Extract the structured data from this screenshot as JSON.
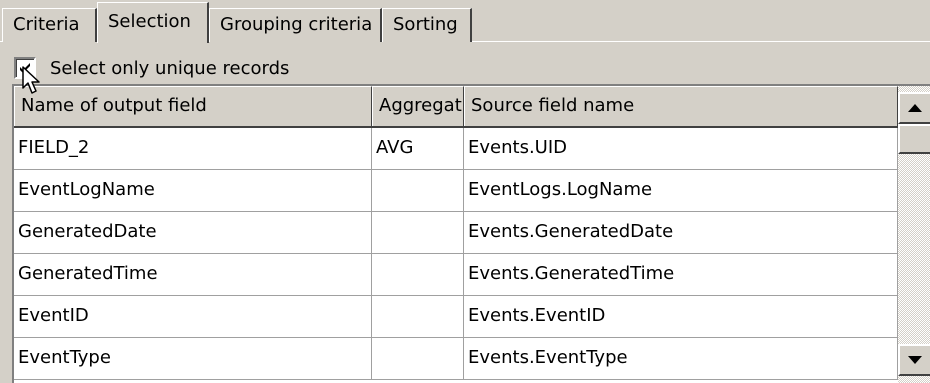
{
  "tabs": [
    {
      "label": "Criteria",
      "active": false
    },
    {
      "label": "Selection",
      "active": true
    },
    {
      "label": "Grouping criteria",
      "active": false
    },
    {
      "label": "Sorting",
      "active": false
    }
  ],
  "options": {
    "unique_records_label": "Select only unique records",
    "unique_records_checked": true
  },
  "grid": {
    "columns": [
      "Name of output field",
      "Aggregat",
      "Source field name"
    ],
    "rows": [
      {
        "name": "FIELD_2",
        "aggregate": "AVG",
        "source": "Events.UID"
      },
      {
        "name": "EventLogName",
        "aggregate": "",
        "source": "EventLogs.LogName"
      },
      {
        "name": "GeneratedDate",
        "aggregate": "",
        "source": "Events.GeneratedDate"
      },
      {
        "name": "GeneratedTime",
        "aggregate": "",
        "source": "Events.GeneratedTime"
      },
      {
        "name": "EventID",
        "aggregate": "",
        "source": "Events.EventID"
      },
      {
        "name": "EventType",
        "aggregate": "",
        "source": "Events.EventType"
      }
    ]
  },
  "colors": {
    "face": "#d4d0c8",
    "window": "#ffffff",
    "shadow": "#808080",
    "dark_shadow": "#404040"
  }
}
